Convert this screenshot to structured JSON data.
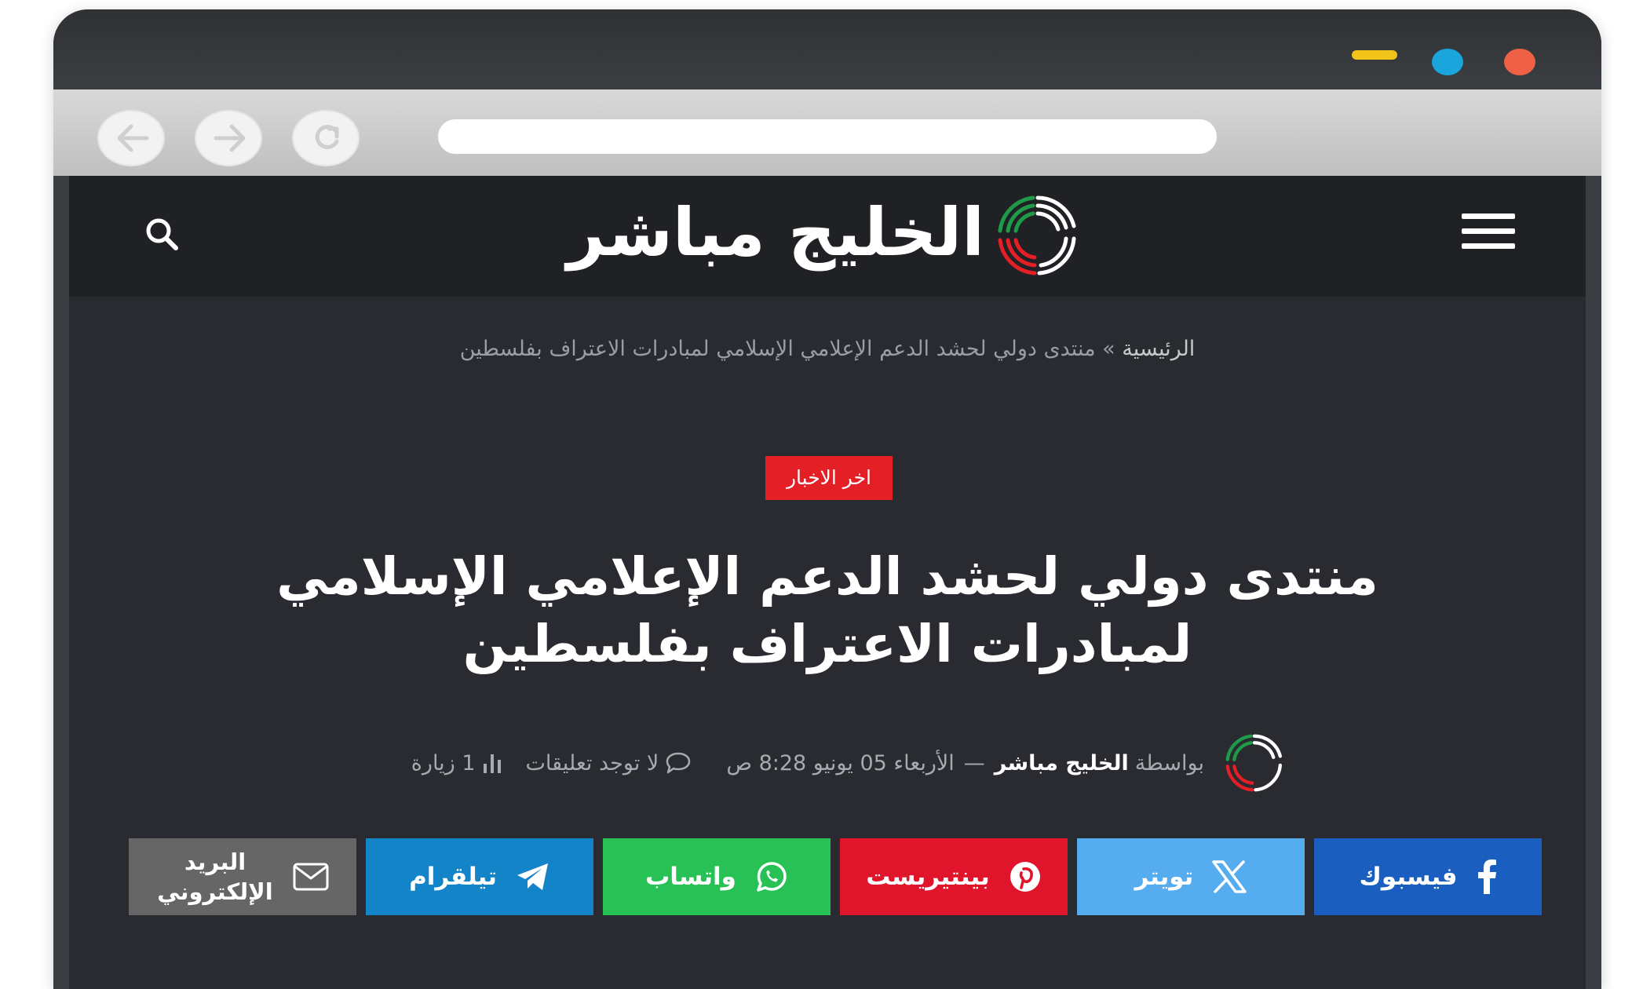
{
  "site": {
    "name": "الخليج مباشر"
  },
  "breadcrumb": {
    "home": "الرئيسية",
    "separator": "»",
    "current": "منتدى دولي لحشد الدعم الإعلامي الإسلامي لمبادرات الاعتراف بفلسطين"
  },
  "article": {
    "category": "اخر الاخبار",
    "title": "منتدى دولي لحشد الدعم الإعلامي الإسلامي لمبادرات الاعتراف بفلسطين",
    "by_label": "بواسطة",
    "author": "الخليج مباشر",
    "dash": "—",
    "date": "الأربعاء 05 يونيو 8:28 ص",
    "comments": "لا توجد تعليقات",
    "views": "1 زيارة"
  },
  "share": [
    {
      "label": "فيسبوك",
      "icon": "facebook-icon",
      "color": "#1a5fbf"
    },
    {
      "label": "تويتر",
      "icon": "x-twitter-icon",
      "color": "#55acee"
    },
    {
      "label": "بينتيريست",
      "icon": "pinterest-icon",
      "color": "#e0142b"
    },
    {
      "label": "واتساب",
      "icon": "whatsapp-icon",
      "color": "#28c155"
    },
    {
      "label": "تيلقرام",
      "icon": "telegram-icon",
      "color": "#1484c9"
    },
    {
      "label": "البريد الإلكتروني",
      "icon": "email-icon",
      "color": "#666666"
    }
  ],
  "colors": {
    "header_bg": "#1f2124",
    "page_bg": "#292b30",
    "category_red": "#e41f26",
    "window_min": "#f2c318",
    "window_max": "#1aa6dc",
    "window_close": "#ee6145"
  }
}
